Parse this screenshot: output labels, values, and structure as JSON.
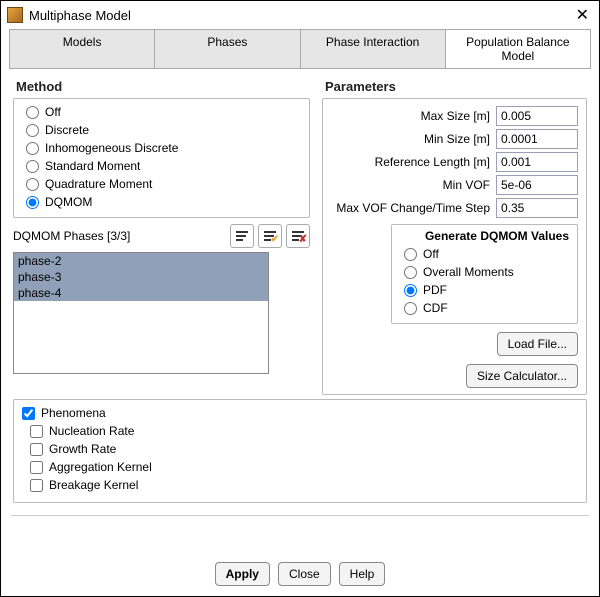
{
  "window": {
    "title": "Multiphase Model"
  },
  "tabs": [
    "Models",
    "Phases",
    "Phase Interaction",
    "Population Balance Model"
  ],
  "method": {
    "title": "Method",
    "options": [
      "Off",
      "Discrete",
      "Inhomogeneous Discrete",
      "Standard Moment",
      "Quadrature Moment",
      "DQMOM"
    ],
    "selected": "DQMOM"
  },
  "dqmom_phases": {
    "label": "DQMOM Phases [3/3]",
    "items": [
      "phase-2",
      "phase-3",
      "phase-4"
    ]
  },
  "parameters": {
    "title": "Parameters",
    "rows": [
      {
        "label": "Max Size [m]",
        "value": "0.005"
      },
      {
        "label": "Min Size [m]",
        "value": "0.0001"
      },
      {
        "label": "Reference Length [m]",
        "value": "0.001"
      },
      {
        "label": "Min VOF",
        "value": "5e-06"
      },
      {
        "label": "Max VOF Change/Time Step",
        "value": "0.35"
      }
    ],
    "generate": {
      "title": "Generate DQMOM Values",
      "options": [
        "Off",
        "Overall Moments",
        "PDF",
        "CDF"
      ],
      "selected": "PDF"
    },
    "load_file": "Load File...",
    "size_calc": "Size Calculator..."
  },
  "phenomena": {
    "label": "Phenomena",
    "checked": true,
    "items": [
      "Nucleation Rate",
      "Growth Rate",
      "Aggregation Kernel",
      "Breakage Kernel"
    ]
  },
  "footer": {
    "apply": "Apply",
    "close": "Close",
    "help": "Help"
  }
}
